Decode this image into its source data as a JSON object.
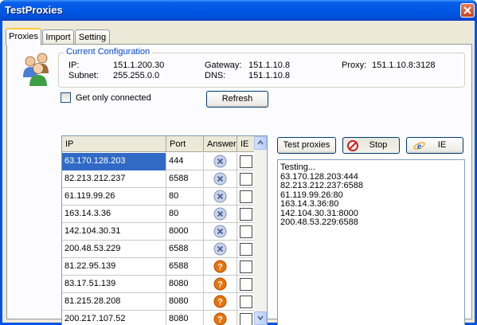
{
  "window": {
    "title": "TestProxies"
  },
  "tabs": [
    {
      "label": "Proxies",
      "active": true
    },
    {
      "label": "Import",
      "active": false
    },
    {
      "label": "Setting",
      "active": false
    }
  ],
  "config": {
    "title": "Current Configuration",
    "ip_label": "IP:",
    "ip": "151.1.200.30",
    "subnet_label": "Subnet:",
    "subnet": "255.255.0.0",
    "gateway_label": "Gateway:",
    "gateway": "151.1.10.8",
    "dns_label": "DNS:",
    "dns": "151.1.10.8",
    "proxy_label": "Proxy:",
    "proxy": "151.1.10.8:3128"
  },
  "controls": {
    "only_connected_label": "Get only connected",
    "only_connected_checked": false,
    "refresh_label": "Refresh",
    "test_label": "Test proxies",
    "stop_label": "Stop",
    "ie_label": "IE"
  },
  "grid": {
    "headers": [
      "IP",
      "Port",
      "Answer",
      "IE"
    ],
    "rows": [
      {
        "ip": "63.170.128.203",
        "port": "444",
        "answer": "x",
        "selected": true
      },
      {
        "ip": "82.213.212.237",
        "port": "6588",
        "answer": "x"
      },
      {
        "ip": "61.119.99.26",
        "port": "80",
        "answer": "x"
      },
      {
        "ip": "163.14.3.36",
        "port": "80",
        "answer": "x"
      },
      {
        "ip": "142.104.30.31",
        "port": "8000",
        "answer": "x"
      },
      {
        "ip": "200.48.53.229",
        "port": "6588",
        "answer": "x"
      },
      {
        "ip": "81.22.95.139",
        "port": "6588",
        "answer": "?"
      },
      {
        "ip": "83.17.51.139",
        "port": "8080",
        "answer": "?"
      },
      {
        "ip": "81.215.28.208",
        "port": "8080",
        "answer": "?"
      },
      {
        "ip": "200.217.107.52",
        "port": "8080",
        "answer": "?"
      }
    ]
  },
  "output": {
    "lines": [
      "Testing...",
      "63.170.128.203:444",
      "82.213.212.237:6588",
      "61.119.99.26:80",
      "163.14.3.36:80",
      "142.104.30.31:8000",
      "200.48.53.229:6588"
    ]
  },
  "icons": {
    "answer_x": "cancel-x-icon",
    "answer_q": "question-icon",
    "stop": "stop-icon",
    "ie": "internet-explorer-icon",
    "avatar": "users-group-icon"
  },
  "colors": {
    "title_bar": "#0058e6",
    "selection": "#316ac5",
    "group_title": "#0046d5",
    "question": "#e8720c"
  }
}
